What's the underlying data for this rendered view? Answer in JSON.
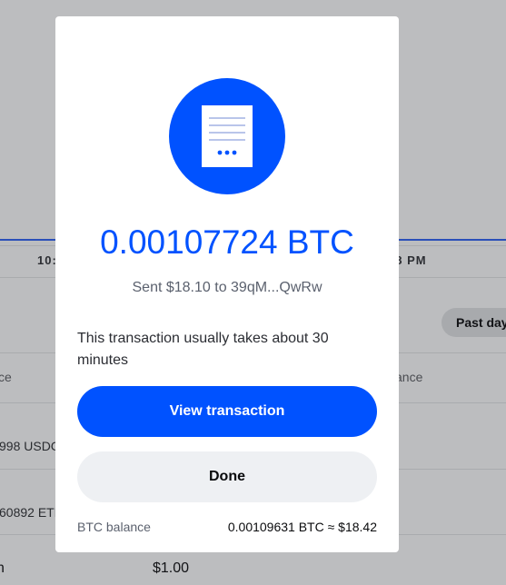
{
  "background": {
    "time_left": "10:",
    "time_right": "08 PM",
    "filter_pill": "Past day",
    "col_left": "ce",
    "col_right": "ance",
    "row1_left": "998 USDC",
    "row2_left": "60892 ETH",
    "row3_left": "n",
    "row3_value": "$1.00"
  },
  "modal": {
    "amount": "0.00107724 BTC",
    "sent_line": "Sent $18.10 to 39qM...QwRw",
    "notice": "This transaction usually takes about 30 minutes",
    "view_button": "View transaction",
    "done_button": "Done",
    "balance_label": "BTC balance",
    "balance_value": "0.00109631 BTC ≈ $18.42",
    "icon": "receipt-icon"
  },
  "colors": {
    "accent": "#0052ff",
    "overlay": "#bcbdbf"
  }
}
